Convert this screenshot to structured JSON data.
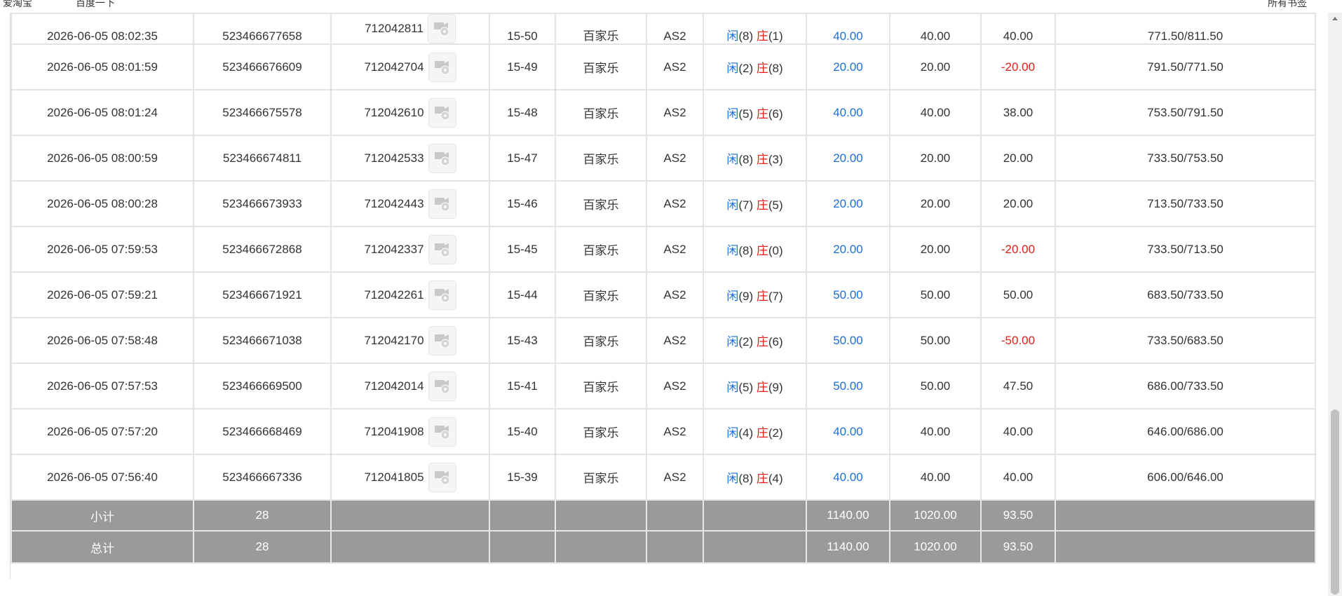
{
  "bookmarks": [
    "爱淘宝",
    "百度一下",
    "所有书签"
  ],
  "rows": [
    {
      "time": "2026-06-05 08:02:35",
      "order": "523466677658",
      "round": "712042811",
      "shoe": "15-50",
      "game": "百家乐",
      "table": "AS2",
      "p_label": "闲",
      "p_val": "(8)",
      "b_label": "庄",
      "b_val": "(1)",
      "bet": "40.00",
      "valid": "40.00",
      "win": "40.00",
      "negative": false,
      "balance": "771.50/811.50"
    },
    {
      "time": "2026-06-05 08:01:59",
      "order": "523466676609",
      "round": "712042704",
      "shoe": "15-49",
      "game": "百家乐",
      "table": "AS2",
      "p_label": "闲",
      "p_val": "(2)",
      "b_label": "庄",
      "b_val": "(8)",
      "bet": "20.00",
      "valid": "20.00",
      "win": "-20.00",
      "negative": true,
      "balance": "791.50/771.50"
    },
    {
      "time": "2026-06-05 08:01:24",
      "order": "523466675578",
      "round": "712042610",
      "shoe": "15-48",
      "game": "百家乐",
      "table": "AS2",
      "p_label": "闲",
      "p_val": "(5)",
      "b_label": "庄",
      "b_val": "(6)",
      "bet": "40.00",
      "valid": "40.00",
      "win": "38.00",
      "negative": false,
      "balance": "753.50/791.50"
    },
    {
      "time": "2026-06-05 08:00:59",
      "order": "523466674811",
      "round": "712042533",
      "shoe": "15-47",
      "game": "百家乐",
      "table": "AS2",
      "p_label": "闲",
      "p_val": "(8)",
      "b_label": "庄",
      "b_val": "(3)",
      "bet": "20.00",
      "valid": "20.00",
      "win": "20.00",
      "negative": false,
      "balance": "733.50/753.50"
    },
    {
      "time": "2026-06-05 08:00:28",
      "order": "523466673933",
      "round": "712042443",
      "shoe": "15-46",
      "game": "百家乐",
      "table": "AS2",
      "p_label": "闲",
      "p_val": "(7)",
      "b_label": "庄",
      "b_val": "(5)",
      "bet": "20.00",
      "valid": "20.00",
      "win": "20.00",
      "negative": false,
      "balance": "713.50/733.50"
    },
    {
      "time": "2026-06-05 07:59:53",
      "order": "523466672868",
      "round": "712042337",
      "shoe": "15-45",
      "game": "百家乐",
      "table": "AS2",
      "p_label": "闲",
      "p_val": "(8)",
      "b_label": "庄",
      "b_val": "(0)",
      "bet": "20.00",
      "valid": "20.00",
      "win": "-20.00",
      "negative": true,
      "balance": "733.50/713.50"
    },
    {
      "time": "2026-06-05 07:59:21",
      "order": "523466671921",
      "round": "712042261",
      "shoe": "15-44",
      "game": "百家乐",
      "table": "AS2",
      "p_label": "闲",
      "p_val": "(9)",
      "b_label": "庄",
      "b_val": "(7)",
      "bet": "50.00",
      "valid": "50.00",
      "win": "50.00",
      "negative": false,
      "balance": "683.50/733.50"
    },
    {
      "time": "2026-06-05 07:58:48",
      "order": "523466671038",
      "round": "712042170",
      "shoe": "15-43",
      "game": "百家乐",
      "table": "AS2",
      "p_label": "闲",
      "p_val": "(2)",
      "b_label": "庄",
      "b_val": "(6)",
      "bet": "50.00",
      "valid": "50.00",
      "win": "-50.00",
      "negative": true,
      "balance": "733.50/683.50"
    },
    {
      "time": "2026-06-05 07:57:53",
      "order": "523466669500",
      "round": "712042014",
      "shoe": "15-41",
      "game": "百家乐",
      "table": "AS2",
      "p_label": "闲",
      "p_val": "(5)",
      "b_label": "庄",
      "b_val": "(9)",
      "bet": "50.00",
      "valid": "50.00",
      "win": "47.50",
      "negative": false,
      "balance": "686.00/733.50"
    },
    {
      "time": "2026-06-05 07:57:20",
      "order": "523466668469",
      "round": "712041908",
      "shoe": "15-40",
      "game": "百家乐",
      "table": "AS2",
      "p_label": "闲",
      "p_val": "(4)",
      "b_label": "庄",
      "b_val": "(2)",
      "bet": "40.00",
      "valid": "40.00",
      "win": "40.00",
      "negative": false,
      "balance": "646.00/686.00"
    },
    {
      "time": "2026-06-05 07:56:40",
      "order": "523466667336",
      "round": "712041805",
      "shoe": "15-39",
      "game": "百家乐",
      "table": "AS2",
      "p_label": "闲",
      "p_val": "(8)",
      "b_label": "庄",
      "b_val": "(4)",
      "bet": "40.00",
      "valid": "40.00",
      "win": "40.00",
      "negative": false,
      "balance": "606.00/646.00"
    }
  ],
  "subtotal": {
    "label": "小计",
    "count": "28",
    "bet": "1140.00",
    "valid": "1020.00",
    "win": "93.50"
  },
  "total": {
    "label": "总计",
    "count": "28",
    "bet": "1140.00",
    "valid": "1020.00",
    "win": "93.50"
  },
  "icons": {
    "replay": "video-replay-icon"
  },
  "colors": {
    "player": "#1a6fd6",
    "banker": "#e0201a",
    "negative": "#e0201a",
    "total_bg": "#9a9a9a"
  }
}
